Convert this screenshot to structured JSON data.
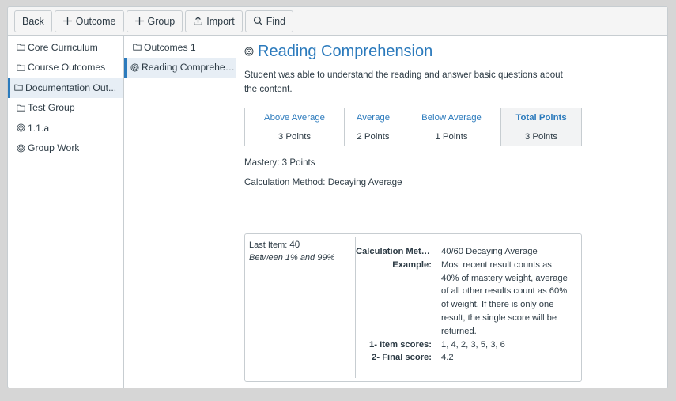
{
  "toolbar": {
    "back": "Back",
    "outcome": "Outcome",
    "group": "Group",
    "import": "Import",
    "find": "Find"
  },
  "groups": [
    {
      "label": "Core Curriculum",
      "icon": "folder-icon"
    },
    {
      "label": "Course Outcomes",
      "icon": "folder-icon"
    },
    {
      "label": "Documentation Out...",
      "icon": "folder-icon",
      "active": true
    },
    {
      "label": "Test Group",
      "icon": "folder-icon"
    },
    {
      "label": "1.1.a",
      "icon": "outcome-icon"
    },
    {
      "label": "Group Work",
      "icon": "outcome-icon"
    }
  ],
  "subitems": [
    {
      "label": "Outcomes 1",
      "icon": "folder-icon"
    },
    {
      "label": "Reading Comprehen...",
      "icon": "outcome-icon",
      "active": true
    }
  ],
  "outcome": {
    "title": "Reading Comprehension",
    "description": "Student was able to understand the reading and answer basic questions about the content.",
    "ratings": [
      {
        "label": "Above Average",
        "points": "3 Points"
      },
      {
        "label": "Average",
        "points": "2 Points"
      },
      {
        "label": "Below Average",
        "points": "1 Points"
      }
    ],
    "total_label": "Total Points",
    "total_points": "3 Points",
    "mastery": "Mastery: 3 Points",
    "calculation": "Calculation Method: Decaying Average"
  },
  "calc_box": {
    "last_item_label": "Last Item:",
    "last_item_value": "40",
    "range": "Between 1% and 99%",
    "method_key": "Calculation Meth...",
    "method_value": "40/60 Decaying Average",
    "example_key": "Example:",
    "example_value": "Most recent result counts as 40% of mastery weight, average of all other results count as 60% of weight. If there is only one result, the single score will be returned.",
    "item_scores_key": "1- Item scores:",
    "item_scores_value": "1, 4, 2, 3, 5, 3, 6",
    "final_score_key": "2- Final score:",
    "final_score_value": "4.2"
  },
  "colors": {
    "accent": "#2b7abc",
    "text": "#2d3b45",
    "border": "#c7cdd1",
    "active_bg": "#e7eef5"
  }
}
